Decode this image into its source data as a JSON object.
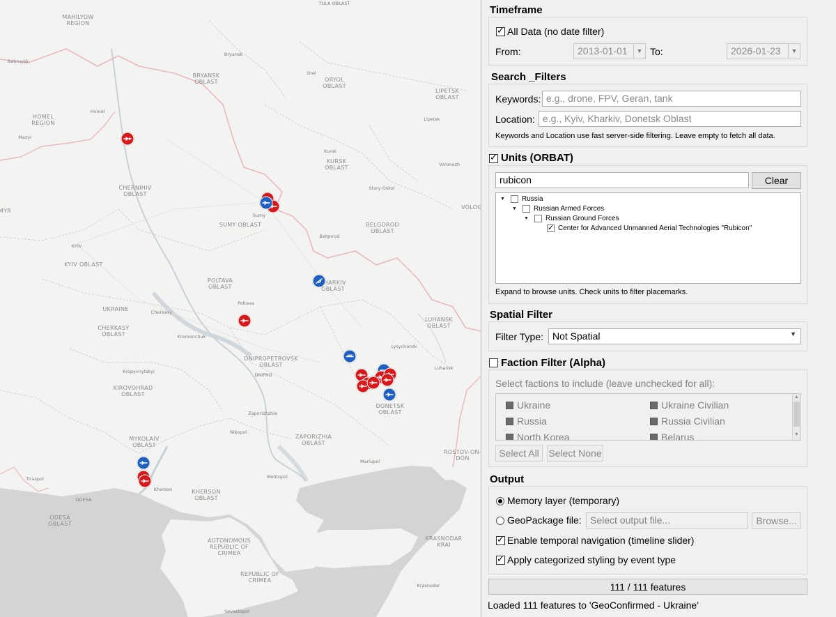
{
  "map": {
    "region_labels": [
      {
        "text": "MAHILYOW\nREGION"
      },
      {
        "text": "HOMEL\nREGION"
      },
      {
        "text": "BRYANSK\nOBLAST"
      },
      {
        "text": "ORYOL\nOBLAST"
      },
      {
        "text": "LIPETSK\nOBLAST"
      },
      {
        "text": "KURSK\nOBLAST"
      },
      {
        "text": "CHERNIHIV\nOBLAST"
      },
      {
        "text": "SUMY OBLAST"
      },
      {
        "text": "BELGOROD\nOBLAST"
      },
      {
        "text": "KYIV OBLAST"
      },
      {
        "text": "POLTAVA\nOBLAST"
      },
      {
        "text": "KHARKIV\nOBLAST"
      },
      {
        "text": "UKRAINE"
      },
      {
        "text": "CHERKASY\nOBLAST"
      },
      {
        "text": "LUHANSK\nOBLAST"
      },
      {
        "text": "DNIPROPETROVSK\nOBLAST"
      },
      {
        "text": "KIROVOHRAD\nOBLAST"
      },
      {
        "text": "DONETSK\nOBLAST"
      },
      {
        "text": "ZAPORIZHIA\nOBLAST"
      },
      {
        "text": "MYKOLAIV\nOBLAST"
      },
      {
        "text": "KHERSON\nOBLAST"
      },
      {
        "text": "ODESA\nOBLAST"
      },
      {
        "text": "AUTONOMOUS\nREPUBLIC OF\nCRIMEA"
      },
      {
        "text": "REPUBLIC OF\nCRIMEA"
      },
      {
        "text": "KRASNODAR\nKRAI"
      },
      {
        "text": "ROSTOV-ON-\nDON"
      },
      {
        "text": "MYR"
      },
      {
        "text": "VOLOGDA"
      }
    ],
    "city_labels": [
      {
        "text": "TULA OBLAST"
      },
      {
        "text": "Bryansk"
      },
      {
        "text": "Babruysk"
      },
      {
        "text": "Orel"
      },
      {
        "text": "Homel"
      },
      {
        "text": "Mazyr"
      },
      {
        "text": "Lipetsk"
      },
      {
        "text": "Kursk"
      },
      {
        "text": "Voronezh"
      },
      {
        "text": "Stary Oskol"
      },
      {
        "text": "Sumy"
      },
      {
        "text": "Belgorod"
      },
      {
        "text": "KYIV"
      },
      {
        "text": "Poltava"
      },
      {
        "text": "Cherkasy"
      },
      {
        "text": "Kremenchuk"
      },
      {
        "text": "Lysychansk"
      },
      {
        "text": "Luhansk"
      },
      {
        "text": "DNIPRO"
      },
      {
        "text": "Kropyvnytskyi"
      },
      {
        "text": "Zaporizhzhia"
      },
      {
        "text": "Nikopol"
      },
      {
        "text": "Mariupol"
      },
      {
        "text": "Melitopol"
      },
      {
        "text": "Tiraspol"
      },
      {
        "text": "Kherson"
      },
      {
        "text": "ODESA"
      },
      {
        "text": "Sevastopol"
      },
      {
        "text": "Krasnodar"
      }
    ],
    "marker_colors": {
      "red": "#d7191c",
      "blue": "#1f5fbf"
    }
  },
  "panel": {
    "timeframe": {
      "title": "Timeframe",
      "all_data_label": "All Data (no date filter)",
      "all_data_checked": true,
      "from_label": "From:",
      "from_value": "2013-01-01",
      "to_label": "To:",
      "to_value": "2026-01-23"
    },
    "search_filters": {
      "title": "Search _Filters",
      "keywords_label": "Keywords:",
      "keywords_placeholder": "e.g., drone, FPV, Geran, tank",
      "location_label": "Location:",
      "location_placeholder": "e.g., Kyiv, Kharkiv, Donetsk Oblast",
      "note": "Keywords and Location use fast server-side filtering. Leave empty to fetch all data."
    },
    "units": {
      "title": "Units (ORBAT)",
      "checked": true,
      "search_value": "rubicon",
      "clear_label": "Clear",
      "tree": [
        {
          "label": "Russia",
          "level": 0,
          "checked": false,
          "expanded": true
        },
        {
          "label": "Russian Armed Forces",
          "level": 1,
          "checked": false,
          "expanded": true
        },
        {
          "label": "Russian Ground Forces",
          "level": 2,
          "checked": false,
          "expanded": true
        },
        {
          "label": "Center for Advanced Unmanned Aerial Technologies \"Rubicon\"",
          "level": 3,
          "checked": true,
          "expanded": false
        }
      ],
      "note": "Expand to browse units. Check units to filter placemarks."
    },
    "spatial": {
      "title": "Spatial Filter",
      "filter_type_label": "Filter Type:",
      "filter_type_value": "Not Spatial"
    },
    "faction": {
      "title": "Faction Filter (Alpha)",
      "checked": false,
      "instructions": "Select factions to include (leave unchecked for all):",
      "items": [
        {
          "label": "Ukraine"
        },
        {
          "label": "Ukraine Civilian"
        },
        {
          "label": "Russia"
        },
        {
          "label": "Russia Civilian"
        },
        {
          "label": "North Korea"
        },
        {
          "label": "Belarus"
        }
      ],
      "select_all_label": "Select All",
      "select_none_label": "Select None"
    },
    "output": {
      "title": "Output",
      "memory_label": "Memory layer (temporary)",
      "memory_selected": true,
      "geopackage_label": "GeoPackage file:",
      "geopackage_placeholder": "Select output file...",
      "browse_label": "Browse...",
      "temporal_label": "Enable temporal navigation (timeline slider)",
      "temporal_checked": true,
      "styling_label": "Apply categorized styling by event type",
      "styling_checked": true
    },
    "progress_text": "111 / 111 features",
    "progress": 1.0,
    "status_text": "Loaded 111 features to 'GeoConfirmed - Ukraine'"
  }
}
